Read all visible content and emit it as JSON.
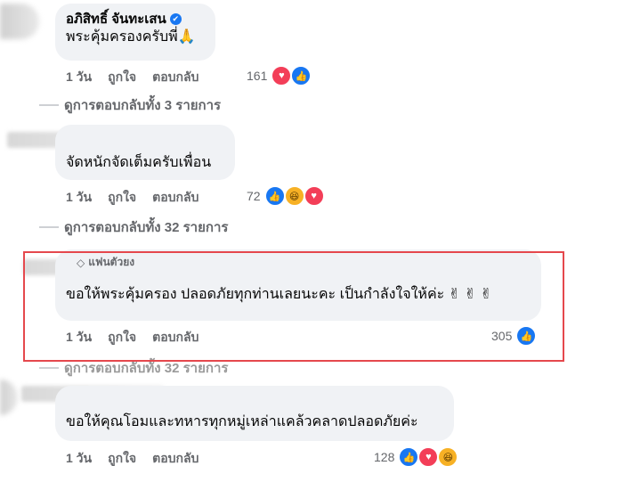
{
  "comments": [
    {
      "author": "อภิสิทธิ์ จันทะเสน",
      "verified_icon": "✔",
      "text": "พระคุ้มครองครับพี่🙏",
      "time": "1 วัน",
      "like": "ถูกใจ",
      "reply": "ตอบกลับ",
      "reaction_count": "161",
      "reactions": [
        "love",
        "like"
      ],
      "view_replies": "ดูการตอบกลับทั้ง 3 รายการ"
    },
    {
      "text": "จัดหนักจัดเต็มครับเพื่อน",
      "time": "1 วัน",
      "like": "ถูกใจ",
      "reply": "ตอบกลับ",
      "reaction_count": "72",
      "reactions": [
        "like",
        "haha",
        "love"
      ],
      "view_replies": "ดูการตอบกลับทั้ง 32 รายการ"
    },
    {
      "badge": "แฟนตัวยง",
      "text": "ขอให้พระคุ้มครอง ปลอดภัยทุกท่านเลยนะคะ เป็นกำลังใจให้ค่ะ ✌ ✌ ✌",
      "time": "1 วัน",
      "like": "ถูกใจ",
      "reply": "ตอบกลับ",
      "reaction_count": "305",
      "reactions": [
        "like"
      ],
      "view_replies": "ดูการตอบกลับทั้ง 32 รายการ"
    },
    {
      "text": "ขอให้คุณโอมและทหารทุกหมู่เหล่าแคล้วคลาดปลอดภัยค่ะ",
      "time": "1 วัน",
      "like": "ถูกใจ",
      "reply": "ตอบกลับ",
      "reaction_count": "128",
      "reactions": [
        "like",
        "love",
        "haha"
      ]
    }
  ],
  "colors": {
    "highlight": "#e5484d",
    "like": "#1877f2",
    "love": "#f33e58",
    "haha": "#f7b125"
  }
}
